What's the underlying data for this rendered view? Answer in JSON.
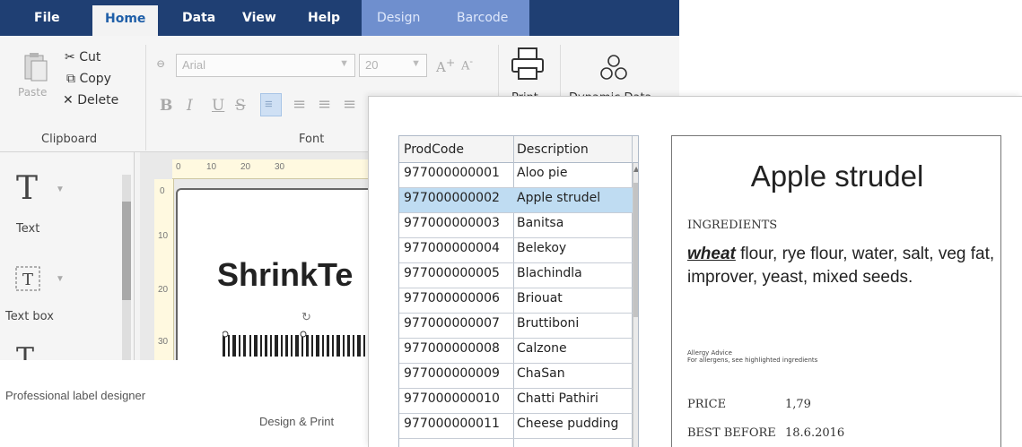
{
  "menubar": {
    "tabs": [
      "File",
      "Home",
      "Data",
      "View",
      "Help"
    ],
    "contextual_tabs": [
      "Design",
      "Barcode"
    ],
    "active_tab": "Home",
    "colors": {
      "bar": "#1f3f73",
      "contextual": "#6f8fce",
      "active_text": "#1f5fa8"
    }
  },
  "ribbon": {
    "clipboard": {
      "paste": "Paste",
      "cut": "Cut",
      "copy": "Copy",
      "delete": "Delete",
      "group": "Clipboard"
    },
    "font": {
      "family": "Arial",
      "size": "20",
      "bold": "B",
      "italic": "I",
      "underline": "U",
      "strike": "S",
      "group": "Font"
    },
    "print": "Print",
    "dynamic_data": "Dynamic Data"
  },
  "toolbox": {
    "text": "Text",
    "text_box": "Text box"
  },
  "canvas": {
    "ruler_marks": [
      "0",
      "10",
      "20",
      "30"
    ],
    "ruler_v_marks": [
      "0",
      "10",
      "20",
      "30"
    ],
    "label_text": "ShrinkTe"
  },
  "data_table": {
    "columns": [
      "ProdCode",
      "Description"
    ],
    "rows": [
      [
        "977000000001",
        "Aloo pie"
      ],
      [
        "977000000002",
        "Apple strudel"
      ],
      [
        "977000000003",
        "Banitsa"
      ],
      [
        "977000000004",
        "Belekoy"
      ],
      [
        "977000000005",
        "Blachindla"
      ],
      [
        "977000000006",
        "Briouat"
      ],
      [
        "977000000007",
        "Bruttiboni"
      ],
      [
        "977000000008",
        "Calzone"
      ],
      [
        "977000000009",
        "ChaSan"
      ],
      [
        "977000000010",
        "Chatti Pathiri"
      ],
      [
        "977000000011",
        "Cheese pudding"
      ]
    ],
    "selected_row": 1
  },
  "preview": {
    "title": "Apple strudel",
    "ingredients_heading": "INGREDIENTS",
    "allergen": "wheat",
    "ingredients_rest": " flour, rye flour, water, salt, veg fat, improver, yeast, mixed seeds.",
    "allergy_line1": "Allergy Advice",
    "allergy_line2": "For allergens, see highlighted ingredients",
    "price_label": "PRICE",
    "price_value": "1,79",
    "best_before_label": "BEST BEFORE",
    "best_before_value": "18.6.2016"
  },
  "captions": {
    "left": "Professional label designer",
    "center": "Design & Print"
  }
}
